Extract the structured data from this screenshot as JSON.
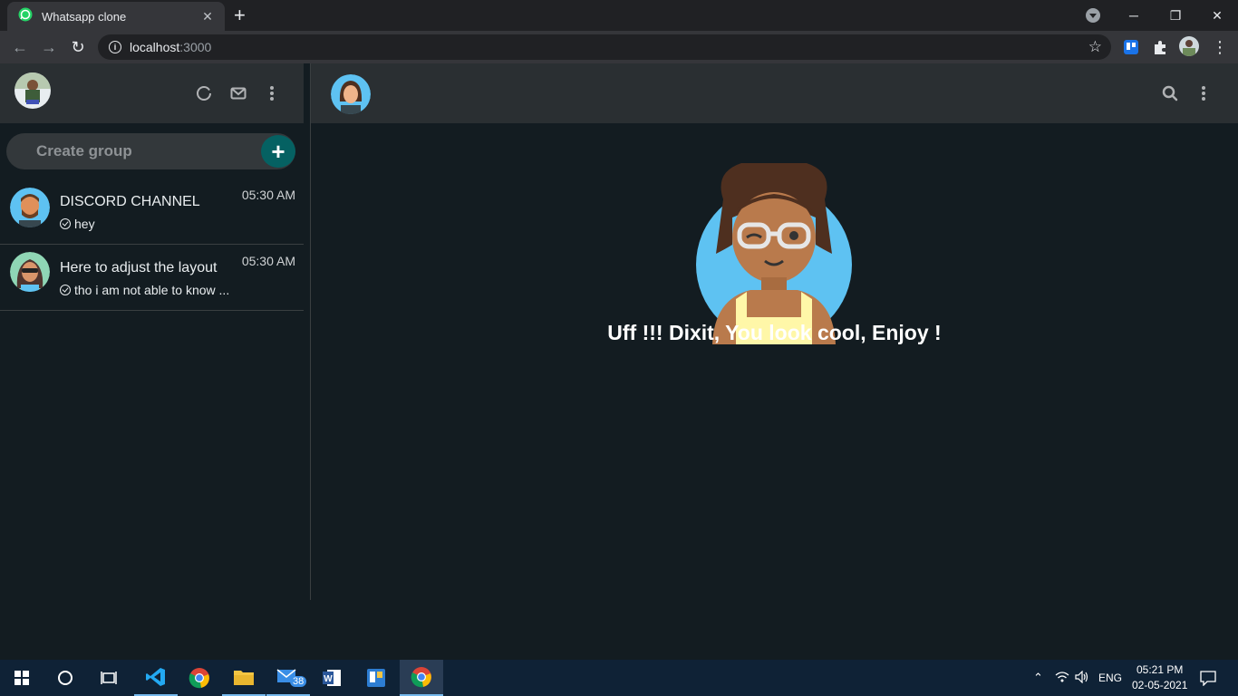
{
  "browser": {
    "tab_title": "Whatsapp clone",
    "tab_close": "✕",
    "new_tab": "+",
    "url_host": "localhost",
    "url_port": ":3000",
    "window_controls": {
      "minimize": "─",
      "restore": "❐",
      "close": "✕"
    }
  },
  "sidebar": {
    "group_input": {
      "placeholder": "Create group",
      "value": ""
    },
    "add_group_label": "+",
    "chats": [
      {
        "name": "DISCORD CHANNEL",
        "time": "05:30 AM",
        "preview": "hey"
      },
      {
        "name": "Here to adjust the layout",
        "time": "05:30 AM",
        "preview": "tho i am not able to know ..."
      }
    ]
  },
  "main": {
    "welcome_text": "Uff !!! Dixit, You look cool, Enjoy !"
  },
  "taskbar": {
    "mail_badge": "38",
    "language": "ENG",
    "time": "05:21 PM",
    "date": "02-05-2021"
  },
  "colors": {
    "app_bg": "#131c21",
    "header_bg": "#2a2f32",
    "accent": "#056162",
    "taskbar_bg": "#0f2236"
  }
}
